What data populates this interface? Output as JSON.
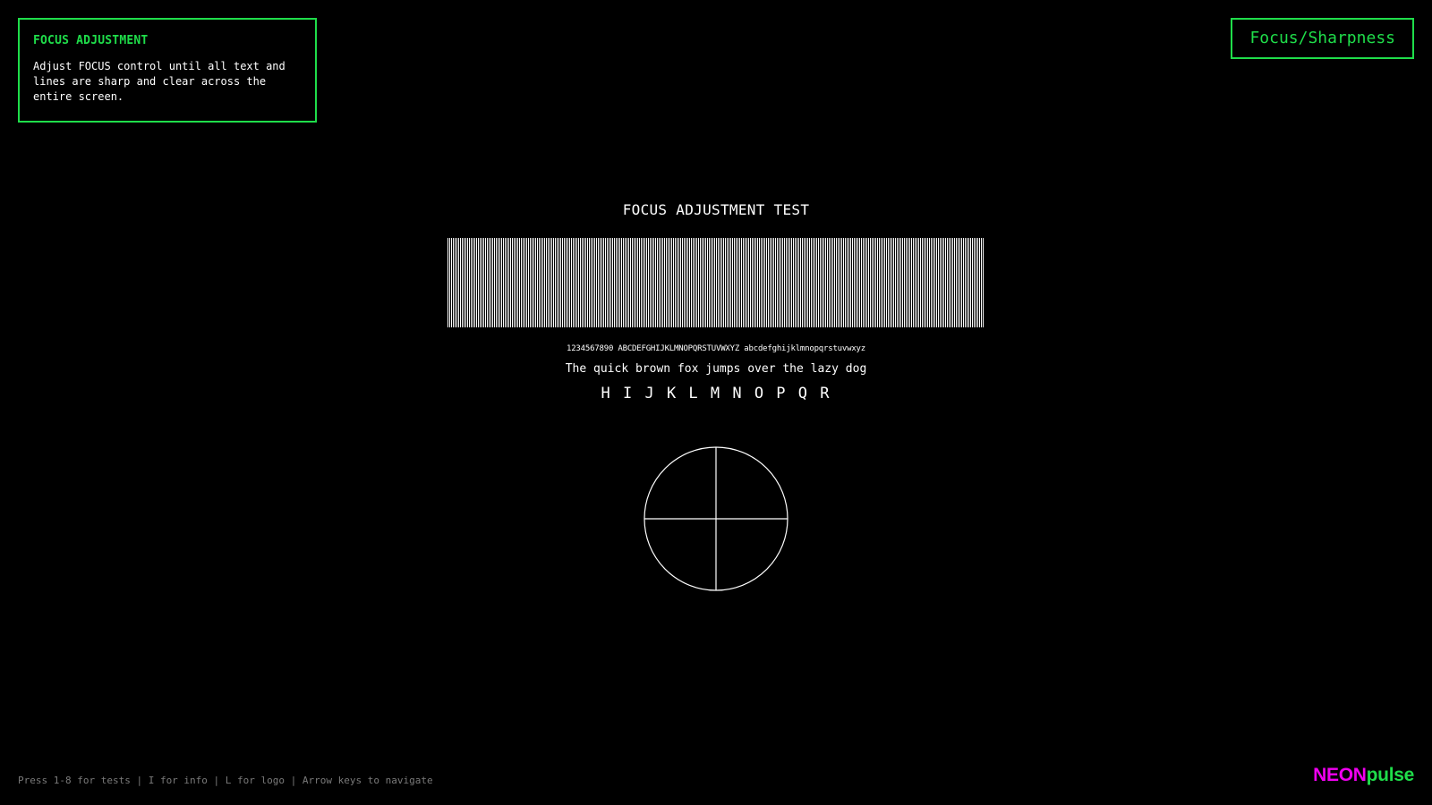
{
  "info_panel": {
    "title": "FOCUS ADJUSTMENT",
    "text": "Adjust FOCUS control until all text and lines are sharp and clear across the entire screen."
  },
  "test_badge": {
    "label": "Focus/Sharpness"
  },
  "focus_test": {
    "title": "FOCUS ADJUSTMENT TEST",
    "tiny_text": "1234567890 ABCDEFGHIJKLMNOPQRSTUVWXYZ abcdefghijklmnopqrstuvwxyz",
    "small_text": "The quick brown fox jumps over the lazy dog",
    "large_text": "H I J K L M N O P Q R"
  },
  "footer": {
    "help": "Press 1-8 for tests | I for info | L for logo | Arrow keys to navigate",
    "logo_part1": "NEON",
    "logo_part2": "pulse"
  },
  "colors": {
    "accent": "#1fdd4a",
    "logo_magenta": "#f000f0",
    "background": "#000000",
    "help_text": "#7a7a7a"
  }
}
